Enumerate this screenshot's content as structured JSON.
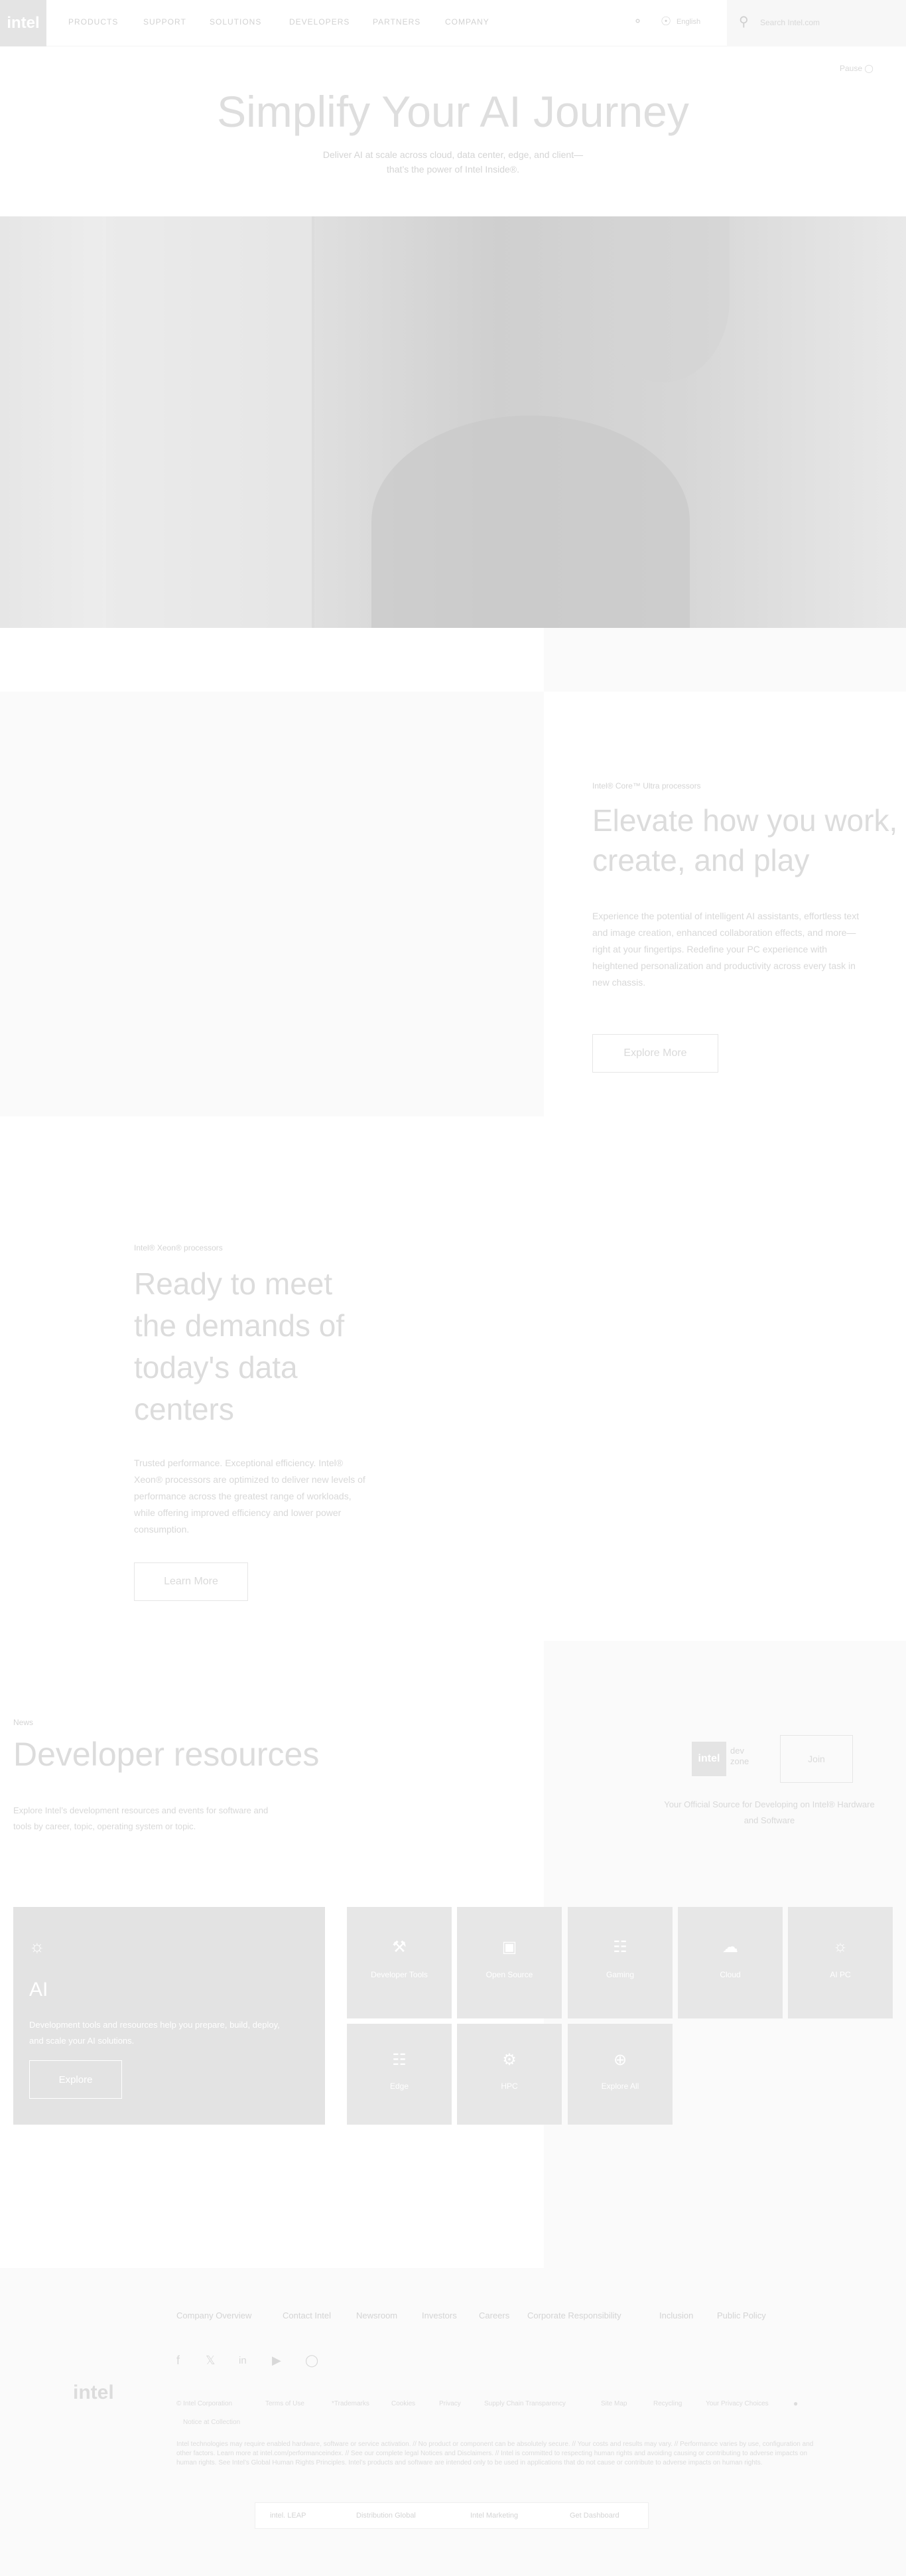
{
  "header": {
    "logo": "intel",
    "nav": [
      "PRODUCTS",
      "SUPPORT",
      "SOLUTIONS",
      "DEVELOPERS",
      "PARTNERS",
      "COMPANY"
    ],
    "locale": "English",
    "search_placeholder": "Search Intel.com"
  },
  "hero": {
    "title": "Simplify Your AI Journey",
    "subtitle": "Deliver AI at scale across cloud, data center, edge, and client—that’s the power of Intel Inside®.",
    "pause": "Pause"
  },
  "core": {
    "eyebrow": "Intel® Core™ Ultra processors",
    "title": "Elevate how you work, create, and play",
    "body": "Experience the potential of intelligent AI assistants, effortless text and image creation, enhanced collaboration effects, and more—right at your fingertips. Redefine your PC experience with heightened personalization and productivity across every task in new chassis.",
    "button": "Explore More"
  },
  "xeon": {
    "eyebrow": "Intel® Xeon® processors",
    "title": "Ready to meet the demands of today's data centers",
    "body": "Trusted performance. Exceptional efficiency. Intel® Xeon® processors are optimized to deliver new levels of performance across the greatest range of workloads, while offering improved efficiency and lower power consumption.",
    "button": "Learn More"
  },
  "developer": {
    "eyebrow": "News",
    "title": "Developer resources",
    "body": "Explore Intel’s development resources and events for software and tools by career, topic, operating system or topic.",
    "devzone_logo": "intel",
    "devzone_text": "dev zone",
    "join_button": "Join",
    "tagline": "Your Official Source for Developing on Intel® Hardware and Software",
    "ai_card": {
      "title": "AI",
      "body": "Development tools and resources help you prepare, build, deploy, and scale your AI solutions.",
      "button": "Explore"
    },
    "tiles": [
      {
        "label": "Developer Tools",
        "icon": "tools-icon"
      },
      {
        "label": "Open Source",
        "icon": "box-icon"
      },
      {
        "label": "Gaming",
        "icon": "gamepad-icon"
      },
      {
        "label": "Cloud",
        "icon": "cloud-icon"
      },
      {
        "label": "AI PC",
        "icon": "brain-icon"
      },
      {
        "label": "Edge",
        "icon": "network-icon"
      },
      {
        "label": "HPC",
        "icon": "chip-icon"
      },
      {
        "label": "Explore All",
        "icon": "plus-circle-icon"
      }
    ]
  },
  "footer": {
    "logo": "intel",
    "links": [
      "Company Overview",
      "Contact Intel",
      "Newsroom",
      "Investors",
      "Careers",
      "Corporate Responsibility",
      "Inclusion",
      "Public Policy"
    ],
    "social": [
      "facebook-icon",
      "x-icon",
      "linkedin-icon",
      "youtube-icon",
      "instagram-icon"
    ],
    "legal_links": [
      "© Intel Corporation",
      "Terms of Use",
      "*Trademarks",
      "Cookies",
      "Privacy",
      "Supply Chain Transparency",
      "Site Map",
      "Recycling",
      "Your Privacy Choices",
      "Notice at Collection"
    ],
    "disclaimer": "Intel technologies may require enabled hardware, software or service activation. // No product or component can be absolutely secure. // Your costs and results may vary. // Performance varies by use, configuration and other factors. Learn more at intel.com/performanceindex. // See our complete legal Notices and Disclaimers. // Intel is committed to respecting human rights and avoiding causing or contributing to adverse impacts on human rights. See Intel’s Global Human Rights Principles. Intel’s products and software are intended only to be used in applications that do not cause or contribute to adverse impacts on human rights.",
    "badges": [
      "intel. LEAP",
      "Distribution Global",
      "Intel Marketing",
      "Get Dashboard"
    ]
  }
}
